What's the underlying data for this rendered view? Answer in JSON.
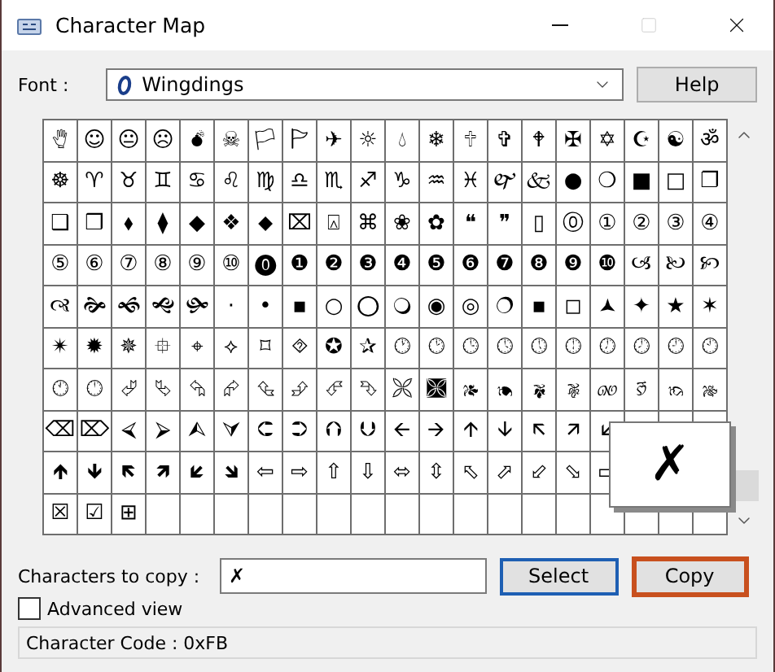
{
  "window": {
    "title": "Character Map"
  },
  "font": {
    "label": "Font :",
    "value": "Wingdings",
    "help": "Help"
  },
  "grid": {
    "rows": [
      [
        "🖐",
        "☺",
        "😐",
        "☹",
        "💣",
        "☠",
        "🏳",
        "🏱",
        "✈",
        "☼",
        "💧",
        "❄",
        "🕆",
        "✞",
        "🕈",
        "✠",
        "✡",
        "☪",
        "☯",
        "ॐ"
      ],
      [
        "☸",
        "♈",
        "♉",
        "♊",
        "♋",
        "♌",
        "♍",
        "♎",
        "♏",
        "♐",
        "♑",
        "♒",
        "♓",
        "🙰",
        "🙵",
        "●",
        "❍",
        "■",
        "□",
        "❐"
      ],
      [
        "❑",
        "❒",
        "⬧",
        "⧫",
        "◆",
        "❖",
        "⬥",
        "⌧",
        "⍓",
        "⌘",
        "❀",
        "✿",
        "❝",
        "❞",
        "▯",
        "⓪",
        "①",
        "②",
        "③",
        "④"
      ],
      [
        "⑤",
        "⑥",
        "⑦",
        "⑧",
        "⑨",
        "⑩",
        "⓿",
        "❶",
        "❷",
        "❸",
        "❹",
        "❺",
        "❻",
        "❼",
        "❽",
        "❾",
        "❿",
        "🙢",
        "🙠",
        "🙡"
      ],
      [
        "🙣",
        "🙞",
        "🙜",
        "🙝",
        "🙟",
        "·",
        "•",
        "▪",
        "○",
        "⭕",
        "🔾",
        "◉",
        "◎",
        "🔿",
        "▪",
        "◻",
        "🟂",
        "✦",
        "★",
        "✶"
      ],
      [
        "✴",
        "✹",
        "✵",
        "⯐",
        "⌖",
        "⟡",
        "⌑",
        "⯑",
        "✪",
        "✰",
        "🕐",
        "🕑",
        "🕒",
        "🕓",
        "🕔",
        "🕕",
        "🕖",
        "🕗",
        "🕘",
        "🕙"
      ],
      [
        "🕚",
        "🕛",
        "⮰",
        "⮱",
        "⮲",
        "⮳",
        "⮴",
        "⮵",
        "⮶",
        "⮷",
        "🙪",
        "🙫",
        "🙕",
        "🙔",
        "🙗",
        "🙖",
        "🙐",
        "🙑",
        "🙒",
        "🙓"
      ],
      [
        "⌫",
        "⌦",
        "⮘",
        "⮚",
        "⮙",
        "⮛",
        "⮈",
        "⮊",
        "⮉",
        "⮋",
        "🡨",
        "🡪",
        "🡩",
        "🡫",
        "🡬",
        "🡭",
        "🡯"
      ],
      [
        "🡹",
        "🡻",
        "🡼",
        "🡽",
        "🡿",
        "🡾",
        "⇦",
        "⇨",
        "⇧",
        "⇩",
        "⬄",
        "⇳",
        "⬁",
        "⬀",
        "⬃",
        "⬂",
        "▭"
      ],
      [
        "☒",
        "☑",
        "⊞"
      ]
    ],
    "enlarged": "✗"
  },
  "copy": {
    "label": "Characters to copy :",
    "value": "✗"
  },
  "buttons": [
    {
      "label": "Select",
      "kind": "default"
    },
    {
      "label": "Copy",
      "kind": "focused"
    }
  ],
  "advanced_view": {
    "label": "Advanced view",
    "checked": false
  },
  "status": "Character Code : 0xFB"
}
